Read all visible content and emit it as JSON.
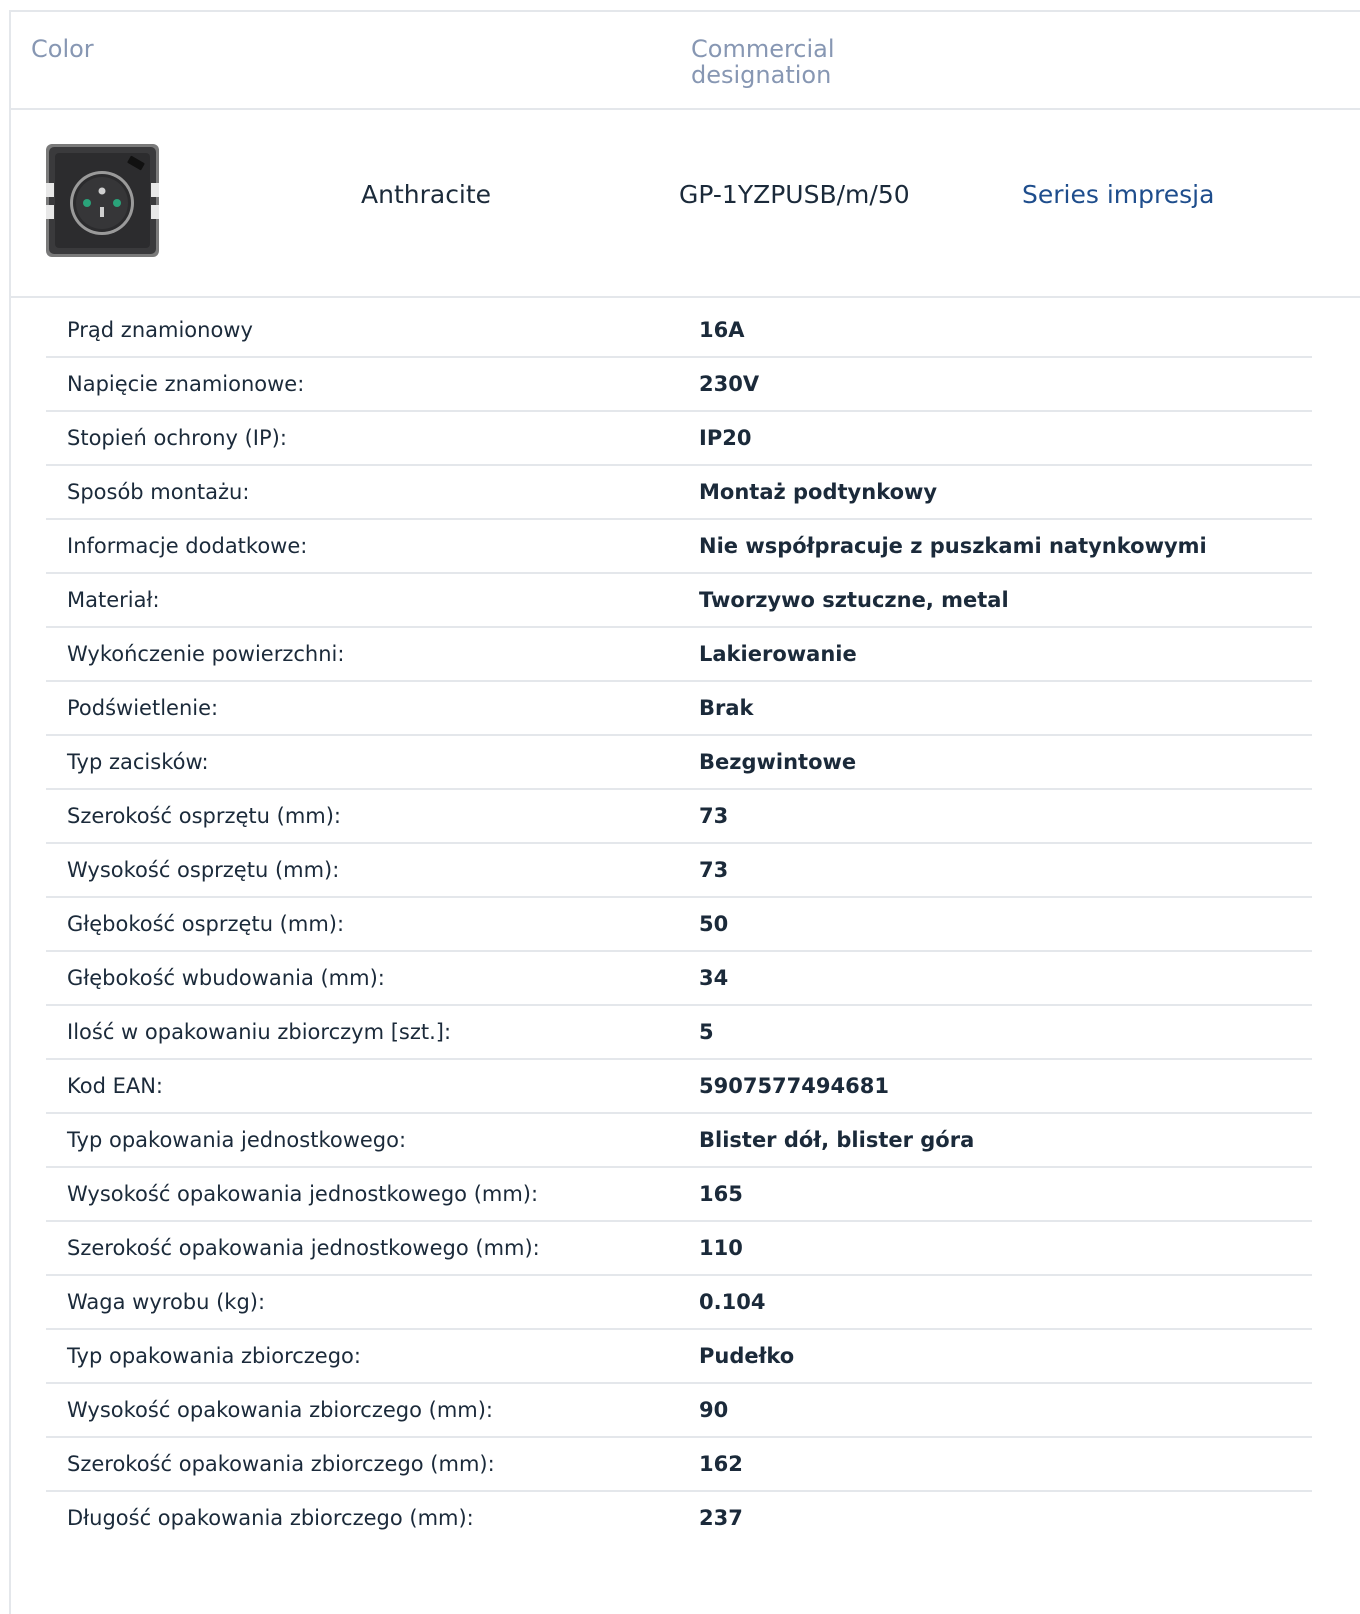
{
  "table_header": {
    "color": "Color",
    "designation": "Commercial designation"
  },
  "product": {
    "image_icon": "socket-thumbnail-icon",
    "color": "Anthracite",
    "designation": "GP-1YZPUSB/m/50",
    "series_link": "Series impresja",
    "link_color": "#1e4d8c"
  },
  "specs": [
    {
      "label": "Prąd znamionowy",
      "value": "16A"
    },
    {
      "label": "Napięcie znamionowe:",
      "value": "230V"
    },
    {
      "label": "Stopień ochrony (IP):",
      "value": "IP20"
    },
    {
      "label": "Sposób montażu:",
      "value": "Montaż podtynkowy"
    },
    {
      "label": "Informacje dodatkowe:",
      "value": "Nie współpracuje z puszkami natynkowymi"
    },
    {
      "label": "Materiał:",
      "value": "Tworzywo sztuczne, metal"
    },
    {
      "label": "Wykończenie powierzchni:",
      "value": "Lakierowanie"
    },
    {
      "label": "Podświetlenie:",
      "value": "Brak"
    },
    {
      "label": "Typ zacisków:",
      "value": "Bezgwintowe"
    },
    {
      "label": "Szerokość osprzętu (mm):",
      "value": "73"
    },
    {
      "label": "Wysokość osprzętu (mm):",
      "value": "73"
    },
    {
      "label": "Głębokość osprzętu (mm):",
      "value": "50"
    },
    {
      "label": "Głębokość wbudowania (mm):",
      "value": "34"
    },
    {
      "label": "Ilość w opakowaniu zbiorczym [szt.]:",
      "value": "5"
    },
    {
      "label": "Kod EAN:",
      "value": "5907577494681"
    },
    {
      "label": "Typ opakowania jednostkowego:",
      "value": "Blister dół, blister góra"
    },
    {
      "label": "Wysokość opakowania jednostkowego (mm):",
      "value": "165"
    },
    {
      "label": "Szerokość opakowania jednostkowego (mm):",
      "value": "110"
    },
    {
      "label": "Waga wyrobu (kg):",
      "value": "0.104"
    },
    {
      "label": "Typ opakowania zbiorczego:",
      "value": "Pudełko"
    },
    {
      "label": "Wysokość opakowania zbiorczego (mm):",
      "value": "90"
    },
    {
      "label": "Szerokość opakowania zbiorczego (mm):",
      "value": "162"
    },
    {
      "label": "Długość opakowania zbiorczego (mm):",
      "value": "237"
    }
  ]
}
